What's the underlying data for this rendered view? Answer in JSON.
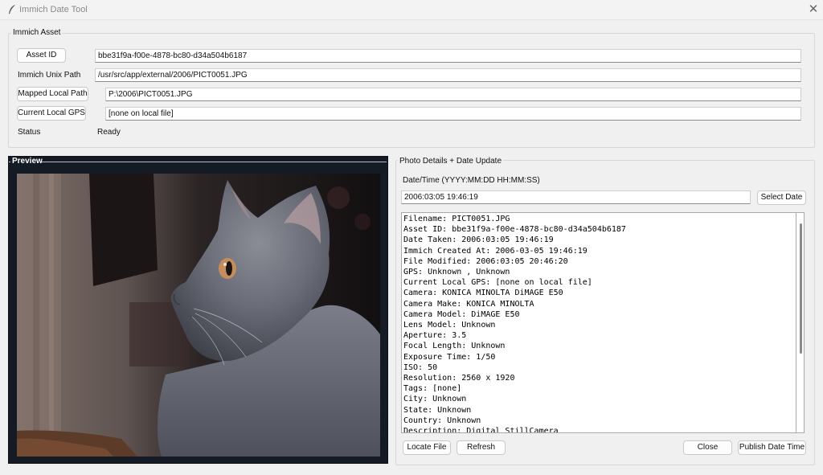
{
  "window": {
    "title": "Immich Date Tool",
    "close_glyph": "✕",
    "icon": "feather-pen-icon"
  },
  "asset_group": {
    "title": "Immich Asset",
    "asset_id_button": "Asset ID",
    "asset_id_value": "bbe31f9a-f00e-4878-bc80-d34a504b6187",
    "unix_path_label": "Immich Unix Path",
    "unix_path_value": "/usr/src/app/external/2006/PICT0051.JPG",
    "mapped_path_button": "Mapped Local Path",
    "mapped_path_value": "P:\\2006\\PICT0051.JPG",
    "gps_button": "Current Local GPS",
    "gps_value": "[none on local file]",
    "status_label": "Status",
    "status_value": "Ready"
  },
  "preview": {
    "title": "Preview",
    "image": "photo of a grey cat in profile"
  },
  "details_group": {
    "title": "Photo Details + Date Update",
    "datetime_label": "Date/Time (YYYY:MM:DD HH:MM:SS)",
    "datetime_value": "2006:03:05 19:46:19",
    "select_date_button": "Select Date",
    "lines": [
      "Filename: PICT0051.JPG",
      "Asset ID: bbe31f9a-f00e-4878-bc80-d34a504b6187",
      "Date Taken: 2006:03:05 19:46:19",
      "Immich Created At: 2006-03-05 19:46:19",
      "File Modified: 2006:03:05 20:46:20",
      "GPS: Unknown , Unknown",
      "Current Local GPS: [none on local file]",
      "Camera: KONICA MINOLTA DiMAGE E50",
      "Camera Make: KONICA MINOLTA",
      "Camera Model: DiMAGE E50",
      "Lens Model: Unknown",
      "Aperture: 3.5",
      "Focal Length: Unknown",
      "Exposure Time: 1/50",
      "ISO: 50",
      "Resolution: 2560 x 1920",
      "Tags: [none]",
      "City: Unknown",
      "State: Unknown",
      "Country: Unknown",
      "Description: Digital StillCamera"
    ],
    "locate_button": "Locate File",
    "refresh_button": "Refresh",
    "close_button": "Close",
    "publish_button": "Publish Date Time"
  },
  "colors": {
    "window_bg": "#f0f0f0",
    "preview_bg": "#141b24"
  }
}
